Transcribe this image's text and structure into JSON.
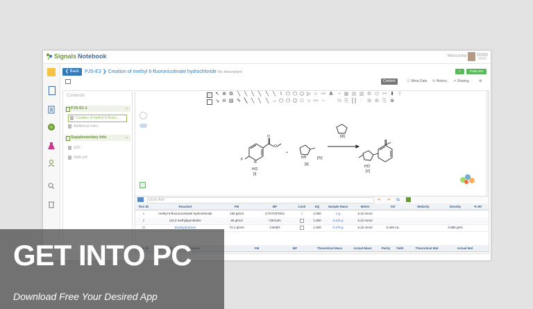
{
  "app": {
    "logo_text_1": "Signals",
    "logo_text_2": "Notebook",
    "welcome": "Welcome"
  },
  "titlebar": {
    "back_label": "❮ Back",
    "experiment_id": "PJS-E3",
    "separator": "❯",
    "title": "Creation of methyl 6-fluoronicotinate hydrochloride",
    "description": "No description",
    "publish_label": "PUBLISH",
    "green_btn_label": "✓"
  },
  "tabs": [
    {
      "label": "Content",
      "active": true
    },
    {
      "label": "Meta Data",
      "active": false
    },
    {
      "label": "History",
      "active": false
    },
    {
      "label": "Sharing",
      "active": false
    }
  ],
  "contents": {
    "title": "Contents",
    "section1": {
      "label": "PJS-E1-1"
    },
    "items1": [
      {
        "label": "Creation of methyl 6-fluoro...",
        "selected": true
      },
      {
        "label": "Additional notes",
        "selected": false
      }
    ],
    "section2": {
      "label": "Supplementary Info"
    },
    "items2": [
      {
        "label": "SDF"
      },
      {
        "label": "NMR.pdf"
      }
    ]
  },
  "reaction": {
    "hcl_label": "HCl",
    "label_1": "[I]",
    "label_2": "[II]",
    "label_3": "[III]",
    "label_4": "[IV]",
    "label_5": "[V]",
    "plus": "+",
    "f_atom": "F",
    "n_atom": "N",
    "nh_atom": "NH",
    "o_atom": "O"
  },
  "quick_add": {
    "placeholder": "Quick Add"
  },
  "reactants_table": {
    "headers": [
      "Rxn ID",
      "Reactant",
      "FM",
      "MF",
      "Limit",
      "EQ",
      "Sample Mass",
      "Moles",
      "Vol",
      "Molarity",
      "Density",
      "% Wt"
    ],
    "rows": [
      {
        "id": "1",
        "name": "methyl 6-fluoronicotinate hydrochloride",
        "fm": "192 g/mol",
        "mf": "C7H7ClFNO2",
        "limit": "✓",
        "eq": "1.000",
        "mass": "1 g",
        "moles": "5.22 mmol",
        "vol": "",
        "molarity": "",
        "density": ""
      },
      {
        "id": "2",
        "name": "(S)-2-methylpyrrolidine",
        "fm": "85 g/mol",
        "mf": "C5H11N",
        "limit": "",
        "eq": "1.000",
        "mass": "0.444 g",
        "moles": "5.22 mmol",
        "vol": "",
        "molarity": "",
        "density": ""
      },
      {
        "id": "III",
        "name": "tetrahydrofuran",
        "fm": "72.1 g/mol",
        "mf": "C4H8O",
        "limit": "",
        "eq": "1.000",
        "mass": "0.376 g",
        "moles": "5.22 mmol",
        "vol": "0.426 mL",
        "molarity": "",
        "density": "0.880 g/ml"
      }
    ]
  },
  "products_table": {
    "headers": [
      "Rxn ID",
      "Product ID",
      "Product",
      "FM",
      "MF",
      "Theoretical Mass",
      "Actual Mass",
      "Purity",
      "Yield",
      "Theoretical Mol",
      "Actual Mol"
    ]
  },
  "watermark": {
    "title": "GET INTO PC",
    "subtitle": "Download Free Your Desired App"
  },
  "colors": {
    "brand_green": "#6a9a2f",
    "brand_blue": "#337ab7",
    "button_green": "#5cb85c"
  }
}
